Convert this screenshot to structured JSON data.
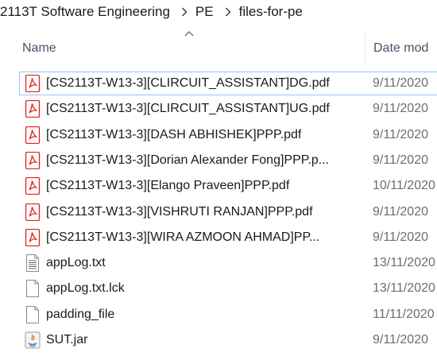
{
  "breadcrumb": {
    "items": [
      "2113T Software Engineering",
      "PE",
      "files-for-pe"
    ]
  },
  "header": {
    "name_label": "Name",
    "date_label": "Date mod",
    "sort": "ascending"
  },
  "files": [
    {
      "name": "[CS2113T-W13-3][CLIRCUIT_ASSISTANT]DG.pdf",
      "date": "9/11/2020",
      "type": "pdf"
    },
    {
      "name": "[CS2113T-W13-3][CLIRCUIT_ASSISTANT]UG.pdf",
      "date": "9/11/2020",
      "type": "pdf"
    },
    {
      "name": "[CS2113T-W13-3][DASH ABHISHEK]PPP.pdf",
      "date": "9/11/2020",
      "type": "pdf"
    },
    {
      "name": "[CS2113T-W13-3][Dorian Alexander Fong]PPP.p...",
      "date": "9/11/2020",
      "type": "pdf"
    },
    {
      "name": "[CS2113T-W13-3][Elango Praveen]PPP.pdf",
      "date": "10/11/2020",
      "type": "pdf"
    },
    {
      "name": "[CS2113T-W13-3][VISHRUTI RANJAN]PPP.pdf",
      "date": "9/11/2020",
      "type": "pdf"
    },
    {
      "name": "[CS2113T-W13-3][WIRA AZMOON AHMAD]PP...",
      "date": "9/11/2020",
      "type": "pdf"
    },
    {
      "name": "appLog.txt",
      "date": "13/11/2020",
      "type": "txt"
    },
    {
      "name": "appLog.txt.lck",
      "date": "13/11/2020",
      "type": "file"
    },
    {
      "name": "padding_file",
      "date": "11/11/2020",
      "type": "file"
    },
    {
      "name": "SUT.jar",
      "date": "9/11/2020",
      "type": "jar"
    }
  ],
  "colors": {
    "pdf_red": "#e0201b",
    "focus_outline": "#99c4ea",
    "header_text": "#44546a",
    "date_text": "#6d6d6d"
  }
}
